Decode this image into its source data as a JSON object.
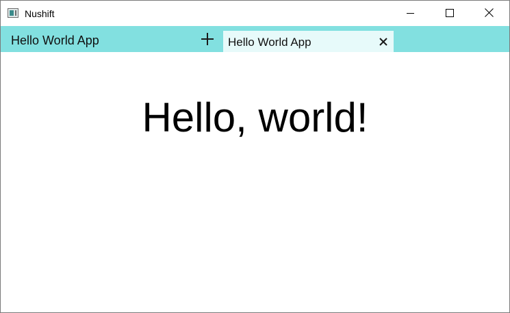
{
  "window": {
    "title": "Nushift"
  },
  "tabbar": {
    "app_name": "Hello World App",
    "tabs": [
      {
        "label": "Hello World App"
      }
    ]
  },
  "content": {
    "greeting": "Hello, world!"
  },
  "colors": {
    "tabbar_bg": "#82e0e0",
    "active_tab_bg": "#e7fafa"
  },
  "icons": {
    "app": "app-window-icon",
    "minimize": "minimize-icon",
    "maximize": "maximize-icon",
    "close": "close-icon",
    "add_tab": "plus-icon",
    "close_tab": "close-tab-icon"
  }
}
